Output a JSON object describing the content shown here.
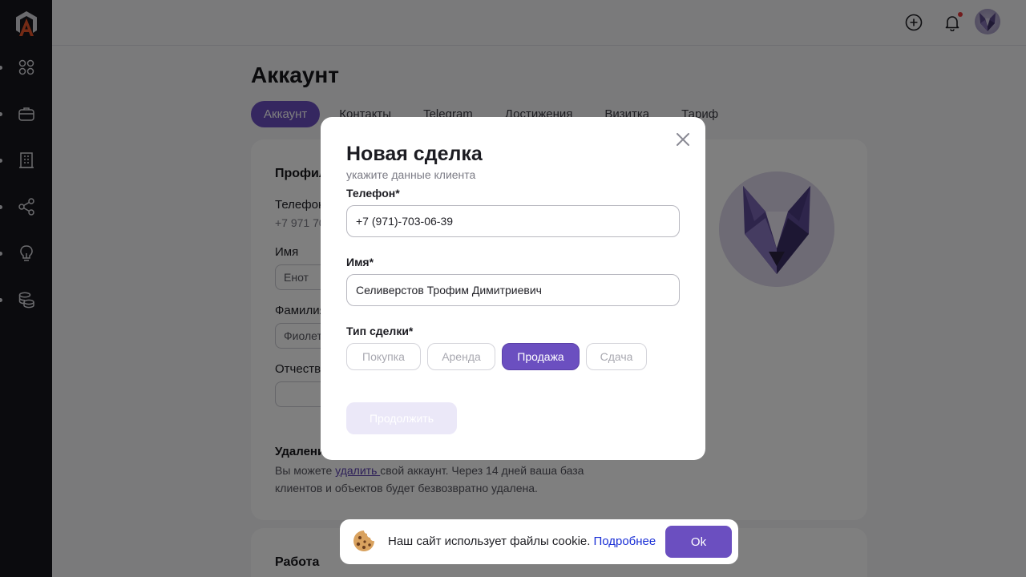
{
  "colors": {
    "accent": "#6b4fc0",
    "sidebar": "#17171c",
    "link": "#1a2fd6",
    "notification": "#e5393a"
  },
  "sidebar": {
    "logo_icon": "a-house-logo-icon",
    "items": [
      {
        "icon": "grid-icon"
      },
      {
        "icon": "briefcase-icon"
      },
      {
        "icon": "building-icon"
      },
      {
        "icon": "share-icon"
      },
      {
        "icon": "lightbulb-icon"
      },
      {
        "icon": "coins-icon"
      }
    ]
  },
  "header": {
    "add_icon": "plus-circle-icon",
    "bell_icon": "bell-icon",
    "avatar_icon": "wolf-avatar"
  },
  "page": {
    "title": "Аккаунт",
    "tabs": [
      {
        "label": "Аккаунт",
        "active": true
      },
      {
        "label": "Контакты"
      },
      {
        "label": "Telegram"
      },
      {
        "label": "Достижения"
      },
      {
        "label": "Визитка"
      },
      {
        "label": "Тариф"
      }
    ],
    "profile": {
      "title": "Профиль",
      "phone_label": "Телефон",
      "phone_value": "+7 971 703-06-39",
      "name_label": "Имя",
      "name_value": "Енот",
      "surname_label": "Фамилия",
      "surname_value": "Фиолетовый",
      "patronymic_label": "Отчество",
      "patronymic_value": ""
    },
    "delete": {
      "title": "Удаление аккаунта",
      "text_before": "Вы можете ",
      "link": "удалить ",
      "text_after": "свой аккаунт. Через 14 дней ваша база клиентов и объектов будет безвозвратно удалена."
    },
    "work": {
      "title": "Работа"
    }
  },
  "modal": {
    "title": "Новая сделка",
    "subtitle": "укажите данные клиента",
    "phone_label": "Телефон*",
    "phone_value": "+7 (971)-703-06-39",
    "name_label": "Имя*",
    "name_value": "Селиверстов Трофим Димитриевич",
    "deal_type_label": "Тип сделки*",
    "deal_types": [
      {
        "label": "Покупка",
        "active": false
      },
      {
        "label": "Аренда",
        "active": false
      },
      {
        "label": "Продажа",
        "active": true
      },
      {
        "label": "Сдача",
        "active": false
      }
    ],
    "continue_label": "Продолжить",
    "close_icon": "close-icon"
  },
  "cookie": {
    "text": "Наш сайт использует файлы cookie.",
    "link": "Подробнее",
    "ok_label": "Ok",
    "icon": "cookie-icon"
  }
}
